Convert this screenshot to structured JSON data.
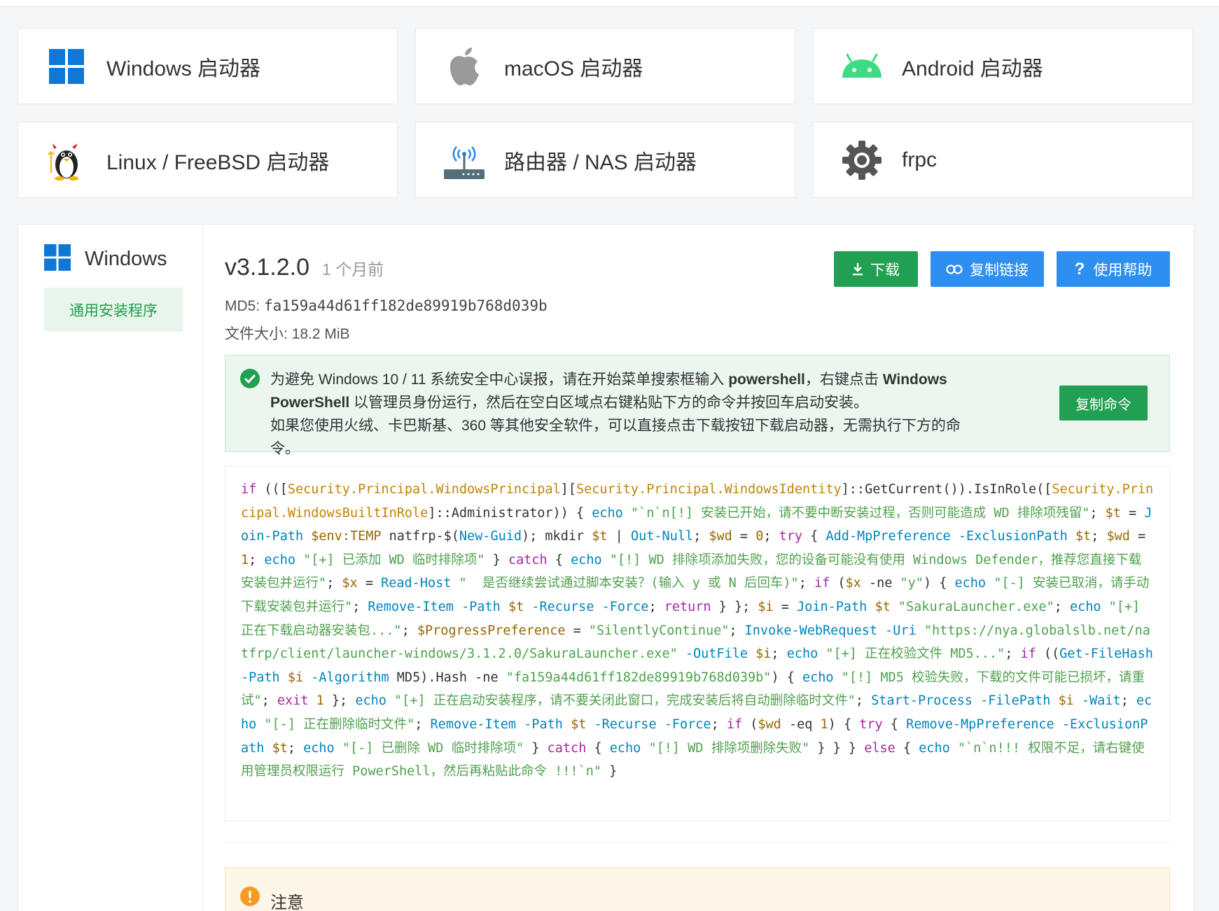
{
  "platforms": [
    {
      "label": "Windows 启动器",
      "icon": "windows-icon"
    },
    {
      "label": "macOS 启动器",
      "icon": "apple-icon"
    },
    {
      "label": "Android 启动器",
      "icon": "android-icon"
    },
    {
      "label": "Linux / FreeBSD 启动器",
      "icon": "linux-tux-icon"
    },
    {
      "label": "路由器 / NAS 启动器",
      "icon": "router-icon"
    },
    {
      "label": "frpc",
      "icon": "gear-icon"
    }
  ],
  "sidebar": {
    "title": "Windows",
    "items": [
      {
        "label": "通用安装程序"
      }
    ]
  },
  "release": {
    "version": "v3.1.2.0",
    "age": "1 个月前",
    "md5_label": "MD5:",
    "md5": "fa159a44d61ff182de89919b768d039b",
    "size_label": "文件大小:",
    "size": "18.2 MiB"
  },
  "buttons": {
    "download": "下载",
    "copy_link": "复制链接",
    "help": "使用帮助"
  },
  "alert": {
    "line1_a": "为避免 Windows 10 / 11 系统安全中心误报，请在开始菜单搜索框输入 ",
    "line1_b": "powershell",
    "line1_c": "，右键点击 ",
    "line1_d": "Windows PowerShell",
    "line1_e": " 以管理员身份运行，然后在空白区域点右键粘贴下方的命令并按回车启动安装。",
    "line2": "如果您使用火绒、卡巴斯基、360 等其他安全软件，可以直接点击下载按钮下载启动器，无需执行下方的命令。",
    "copy_button": "复制命令"
  },
  "notice": {
    "title": "注意"
  },
  "colors": {
    "green": "#21a053",
    "blue": "#2f8ff0",
    "windows_blue": "#0f78d7",
    "android_green": "#3ddc84"
  }
}
